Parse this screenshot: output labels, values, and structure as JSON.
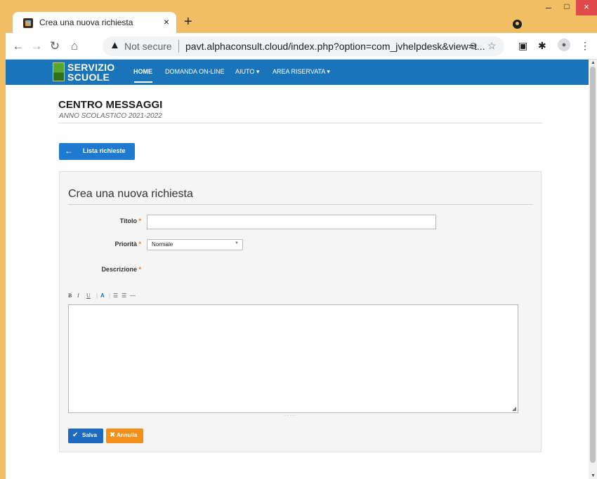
{
  "browser": {
    "tab_title": "Crea una nuova richiesta",
    "tab_close": "×",
    "new_tab": "+",
    "window_min": "–",
    "window_max": "□",
    "window_close": "×",
    "not_secure": "Not secure",
    "url": "pavt.alphaconsult.cloud/index.php?option=com_jvhelpdesk&view=t...",
    "icons": [
      "back-icon",
      "forward-icon",
      "reload-icon",
      "home-icon",
      "warning-icon",
      "zoom-icon",
      "star-icon",
      "cast-icon",
      "extensions-icon",
      "profile-icon",
      "menu-icon"
    ]
  },
  "site": {
    "logo_line1": "SERVIZIO",
    "logo_line2": "SCUOLE",
    "nav": {
      "home": "HOME",
      "domanda": "DOMANDA ON-LINE",
      "aiuto": "AIUTO ▾",
      "area": "AREA RISERVATA ▾"
    },
    "brand_color": "#1a74b9"
  },
  "page": {
    "title": "CENTRO MESSAGGI",
    "subtitle": "ANNO SCOLASTICO 2021-2022",
    "back_button": "Lista richieste"
  },
  "form": {
    "heading": "Crea una nuova richiesta",
    "titolo_label": "Titolo",
    "titolo_value": "",
    "priorita_label": "Priorità",
    "priorita_value": "Normale",
    "descrizione_label": "Descrizione",
    "required_mark": "*",
    "editor_toolbar": {
      "bold": "B",
      "italic": "I",
      "underline": "U",
      "color": "A",
      "bullets": "☰",
      "numbered": "☰",
      "rule": "—"
    },
    "save_button": "Salva",
    "cancel_button": "Annulla",
    "save_color": "#1c6bc0",
    "cancel_color": "#f39019"
  }
}
